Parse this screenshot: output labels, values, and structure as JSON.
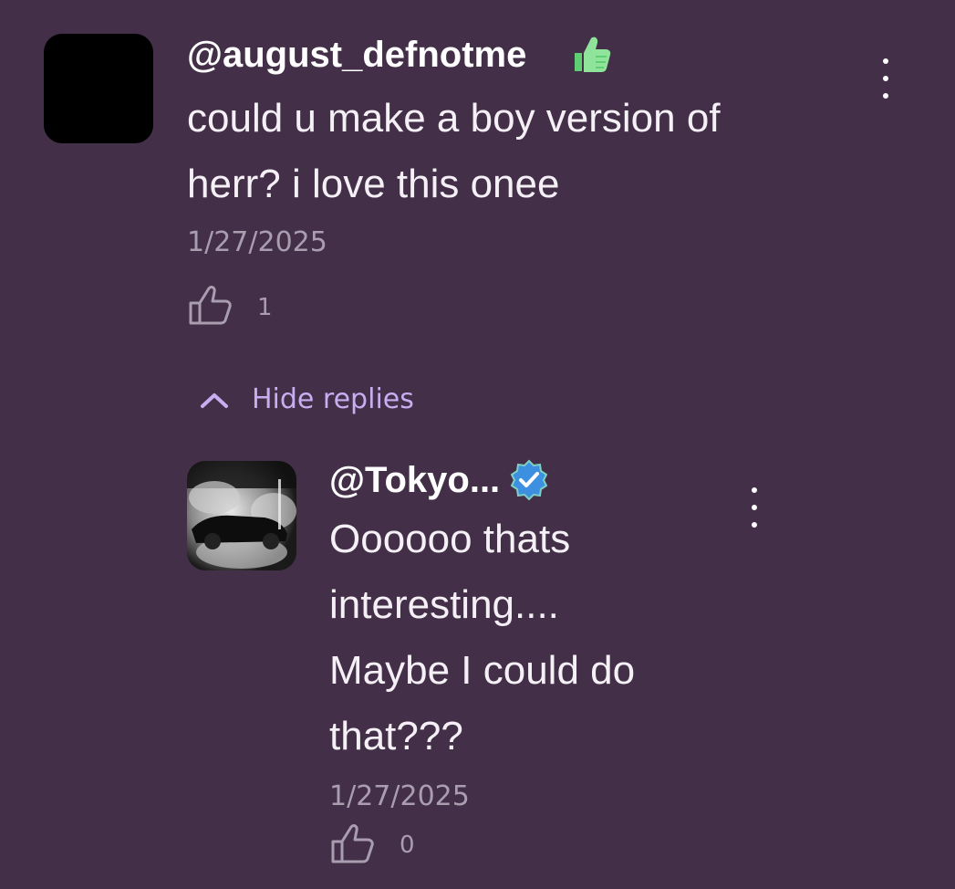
{
  "main_comment": {
    "username": "@august_defnotme",
    "badge_icon": "thumbs-up-icon",
    "text_line1": "could u make a boy version of",
    "text_line2": "herr? i love this onee",
    "date": "1/27/2025",
    "likes": "1"
  },
  "replies_toggle": {
    "label": "Hide replies"
  },
  "reply": {
    "username": "@Tokyo...",
    "badge_icon": "verified-badge-icon",
    "text_line1": "Oooooo thats",
    "text_line2": "interesting....",
    "text_line3": "Maybe I could do",
    "text_line4": "that???",
    "date": "1/27/2025",
    "likes": "0"
  },
  "colors": {
    "background": "#432f48",
    "accent": "#c6aef0",
    "muted": "#a99daf",
    "verified_badge": "#3d8fe0"
  }
}
